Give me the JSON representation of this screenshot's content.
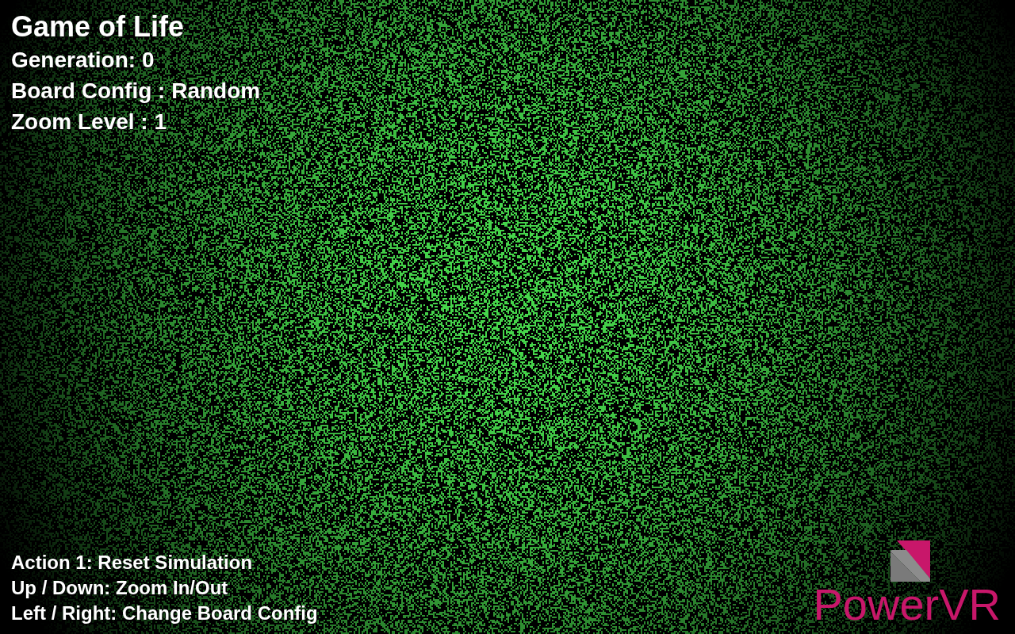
{
  "hud": {
    "title": "Game of Life",
    "lines": [
      "Generation: 0",
      "Board Config : Random",
      "Zoom Level : 1"
    ]
  },
  "controls": [
    "Action 1: Reset Simulation",
    "Up / Down: Zoom In/Out",
    "Left / Right: Change Board Config"
  ],
  "logo": {
    "text": "PowerVR"
  }
}
